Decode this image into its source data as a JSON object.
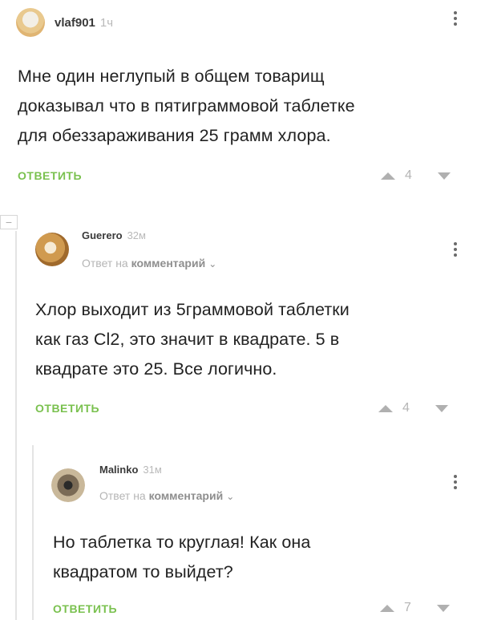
{
  "comments": [
    {
      "author": "vlaf901",
      "time": "1ч",
      "lines": [
        "Мне один неглупый в общем товарищ",
        "доказывал что в пятиграммовой таблетке",
        "для обеззараживания 25 грамм хлора."
      ],
      "reply_label": "ОТВЕТИТЬ",
      "score": "4"
    },
    {
      "author": "Guerero",
      "time": "32м",
      "reply_prefix": "Ответ на",
      "reply_target": "комментарий",
      "lines": [
        "Хлор выходит из 5граммовой таблетки",
        "как газ Cl2, это значит в квадрате. 5 в",
        "квадрате это 25. Все логично."
      ],
      "reply_label": "ОТВЕТИТЬ",
      "score": "4"
    },
    {
      "author": "Malinko",
      "time": "31м",
      "reply_prefix": "Ответ на",
      "reply_target": "комментарий",
      "lines": [
        "Но таблетка то круглая! Как она",
        "квадратом то выйдет?"
      ],
      "reply_label": "ОТВЕТИТЬ",
      "score": "7"
    }
  ],
  "collapse_symbol": "−",
  "colors": {
    "accent": "#7ac14f",
    "muted": "#b5b5b5"
  }
}
